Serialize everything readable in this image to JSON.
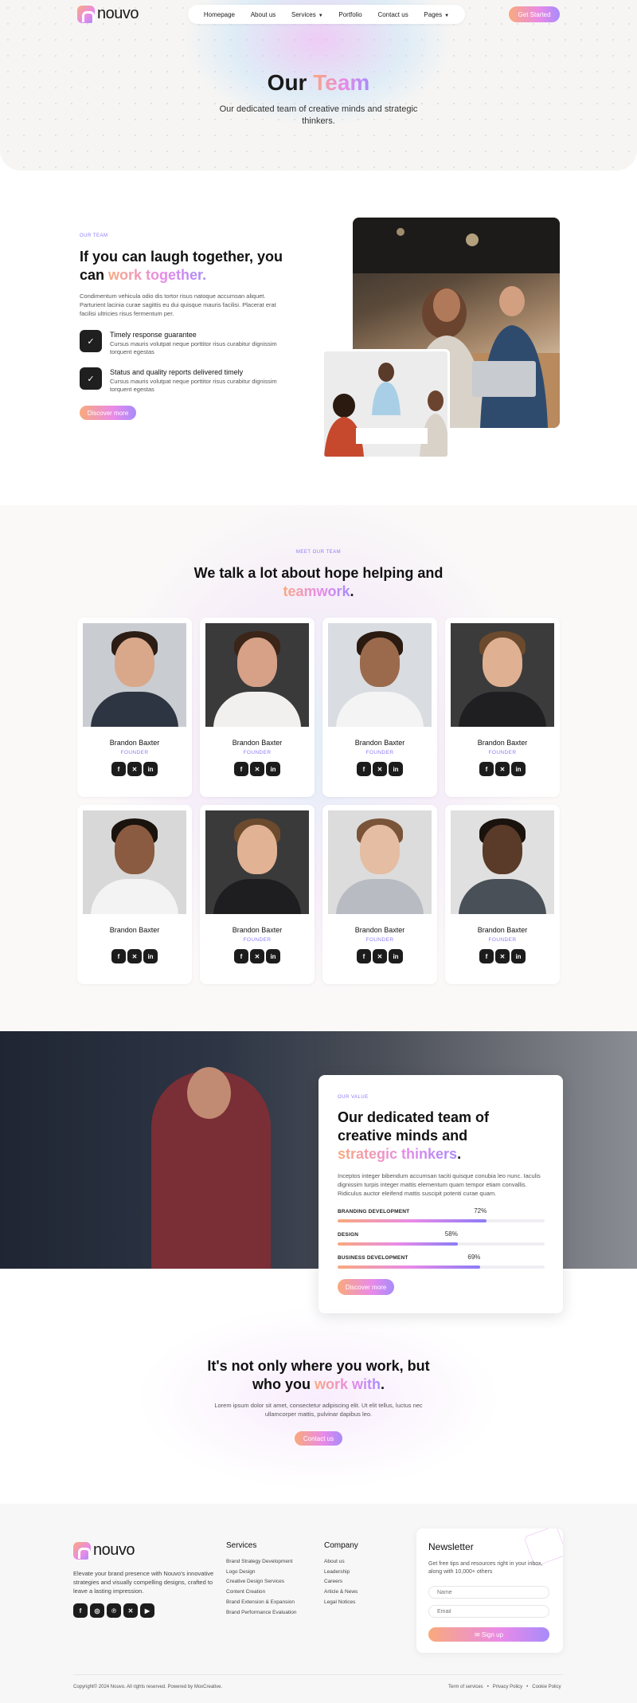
{
  "brand": {
    "name": "nouvo"
  },
  "nav": {
    "items": [
      "Homepage",
      "About us",
      "Services",
      "Portfolio",
      "Contact us",
      "Pages"
    ],
    "cta": "Get Started"
  },
  "hero": {
    "title_plain": "Our",
    "title_accent": "Team",
    "subtitle": "Our dedicated team of creative minds and strategic thinkers."
  },
  "about": {
    "eyebrow": "OUR TEAM",
    "title_plain": "If you can laugh together, you can",
    "title_accent": "work together.",
    "text": "Condimentum vehicula odio dis tortor risus natoque accumsan aliquet. Parturient lacinia curae sagittis eu dui quisque mauris facilisi. Placerat erat facilisi ultricies risus fermentum per.",
    "features": [
      {
        "title": "Timely response guarantee",
        "desc": "Cursus mauris volutpat neque porttitor risus curabitur dignissim torquent egestas"
      },
      {
        "title": "Status and quality reports delivered timely",
        "desc": "Cursus mauris volutpat neque porttitor risus curabitur dignissim torquent egestas"
      }
    ],
    "button": "Discover more"
  },
  "team": {
    "eyebrow": "MEET OUR TEAM",
    "title_plain": "We talk a lot about hope helping and",
    "title_accent": "teamwork",
    "title_end": ".",
    "members": [
      {
        "name": "Brandon Baxter",
        "role": "FOUNDER",
        "skin": "#d9a88a",
        "hair": "#2b1d14",
        "shirt": "#2e3542",
        "bg": "#c9ccd1"
      },
      {
        "name": "Brandon Baxter",
        "role": "FOUNDER",
        "skin": "#d6a187",
        "hair": "#3a2518",
        "shirt": "#f2f0ee",
        "bg": "#3a3a3a"
      },
      {
        "name": "Brandon Baxter",
        "role": "FOUNDER",
        "skin": "#9b6a4d",
        "hair": "#2a1a10",
        "shirt": "#f4f4f4",
        "bg": "#d9dce0"
      },
      {
        "name": "Brandon Baxter",
        "role": "FOUNDER",
        "skin": "#e0b092",
        "hair": "#6b4a2e",
        "shirt": "#1f1f22",
        "bg": "#3b3b3b"
      },
      {
        "name": "Brandon Baxter",
        "role": "",
        "skin": "#8a5b40",
        "hair": "#1a120c",
        "shirt": "#f3f3f3",
        "bg": "#d8d8d8"
      },
      {
        "name": "Brandon Baxter",
        "role": "FOUNDER",
        "skin": "#e2b294",
        "hair": "#6b4a2e",
        "shirt": "#1e1e21",
        "bg": "#3a3a3a"
      },
      {
        "name": "Brandon Baxter",
        "role": "FOUNDER",
        "skin": "#e5bda3",
        "hair": "#7a5438",
        "shirt": "#b8bcc2",
        "bg": "#dcdcdc"
      },
      {
        "name": "Brandon Baxter",
        "role": "FOUNDER",
        "skin": "#5a3a28",
        "hair": "#1a120c",
        "shirt": "#4a5058",
        "bg": "#e0e0e0"
      }
    ]
  },
  "value": {
    "eyebrow": "OUR VALUE",
    "title_plain": "Our dedicated team of creative minds and",
    "title_accent": "strategic thinkers",
    "title_end": ".",
    "text": "Inceptos integer bibendum accumsan taciti quisque conubia leo nunc. Iaculis dignissim turpis integer mattis elementum quam tempor etiam convallis. Ridiculus auctor eleifend mattis suscipit potenti curae quam.",
    "bars": [
      {
        "label": "BRANDING DEVELOPMENT",
        "value": 72,
        "text": "72%"
      },
      {
        "label": "DESIGN",
        "value": 58,
        "text": "58%"
      },
      {
        "label": "BUSINESS DEVELOPMENT",
        "value": 69,
        "text": "69%"
      }
    ],
    "button": "Discover more"
  },
  "cta": {
    "title_plain": "It's not only where you work, but who you",
    "title_accent": "work with",
    "title_end": ".",
    "text": "Lorem ipsum dolor sit amet, consectetur adipiscing elit. Ut elit tellus, luctus nec ullamcorper mattis, pulvinar dapibus leo.",
    "button": "Contact us"
  },
  "footer": {
    "description": "Elevate your brand presence with Nouvo's innovative strategies and visually compelling designs, crafted to leave a lasting impression.",
    "services_title": "Services",
    "services": [
      "Brand Strategy Development",
      "Logo Design",
      "Creative Design Services",
      "Content Creation",
      "Brand Extension & Expansion",
      "Brand Performance Evaluation"
    ],
    "company_title": "Company",
    "company": [
      "About us",
      "Leadership",
      "Careers",
      "Article & News",
      "Legal Notices"
    ],
    "newsletter": {
      "title": "Newsletter",
      "text": "Get free tips and resources right in your inbox, along with 10,000+ others",
      "name_placeholder": "Name",
      "email_placeholder": "Email",
      "button": "Sign up"
    },
    "copyright": "Copyright© 2024 Nouvo. All rights reserved. Powered by MoxCreative.",
    "legal": [
      "Term of services",
      "Privacy Policy",
      "Cookie Policy"
    ]
  },
  "icons": {
    "social_team": [
      "facebook-icon",
      "x-icon",
      "linkedin-icon"
    ],
    "social_footer": [
      "facebook-icon",
      "instagram-icon",
      "pinterest-icon",
      "x-icon",
      "youtube-icon"
    ]
  }
}
